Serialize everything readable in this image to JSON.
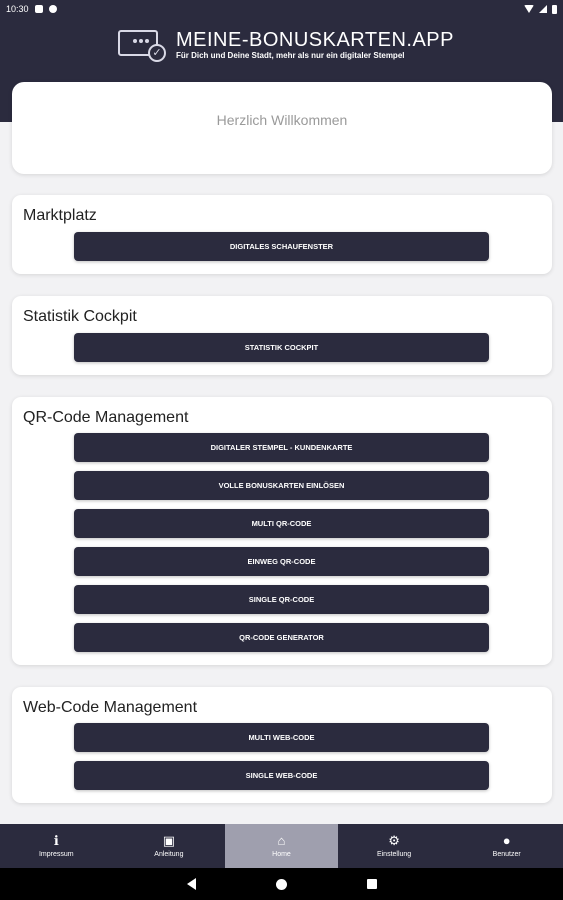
{
  "status_bar": {
    "time": "10:30"
  },
  "header": {
    "brand": "MEINE-BONUSKARTEN.APP",
    "tagline": "Für Dich und Deine Stadt, mehr als nur ein digitaler Stempel"
  },
  "welcome": {
    "text": "Herzlich Willkommen"
  },
  "sections": {
    "marktplatz": {
      "title": "Marktplatz",
      "buttons": [
        "DIGITALES SCHAUFENSTER"
      ]
    },
    "statistik": {
      "title": "Statistik Cockpit",
      "buttons": [
        "STATISTIK COCKPIT"
      ]
    },
    "qr": {
      "title": "QR-Code Management",
      "buttons": [
        "DIGITALER STEMPEL - KUNDENKARTE",
        "VOLLE BONUSKARTEN EINLÖSEN",
        "MULTI QR-CODE",
        "EINWEG QR-CODE",
        "SINGLE QR-CODE",
        "QR-CODE GENERATOR"
      ]
    },
    "web": {
      "title": "Web-Code Management",
      "buttons": [
        "MULTI WEB-CODE",
        "SINGLE WEB-CODE"
      ]
    }
  },
  "nav": {
    "items": [
      {
        "label": "Impressum",
        "icon": "info-icon"
      },
      {
        "label": "Anleitung",
        "icon": "book-icon"
      },
      {
        "label": "Home",
        "icon": "home-icon"
      },
      {
        "label": "Einstellung",
        "icon": "gear-icon"
      },
      {
        "label": "Benutzer",
        "icon": "user-icon"
      }
    ],
    "active": "Home"
  },
  "colors": {
    "primary": "#2b2b3e",
    "background": "#f2f2f4",
    "nav_active": "#9f9fae"
  }
}
